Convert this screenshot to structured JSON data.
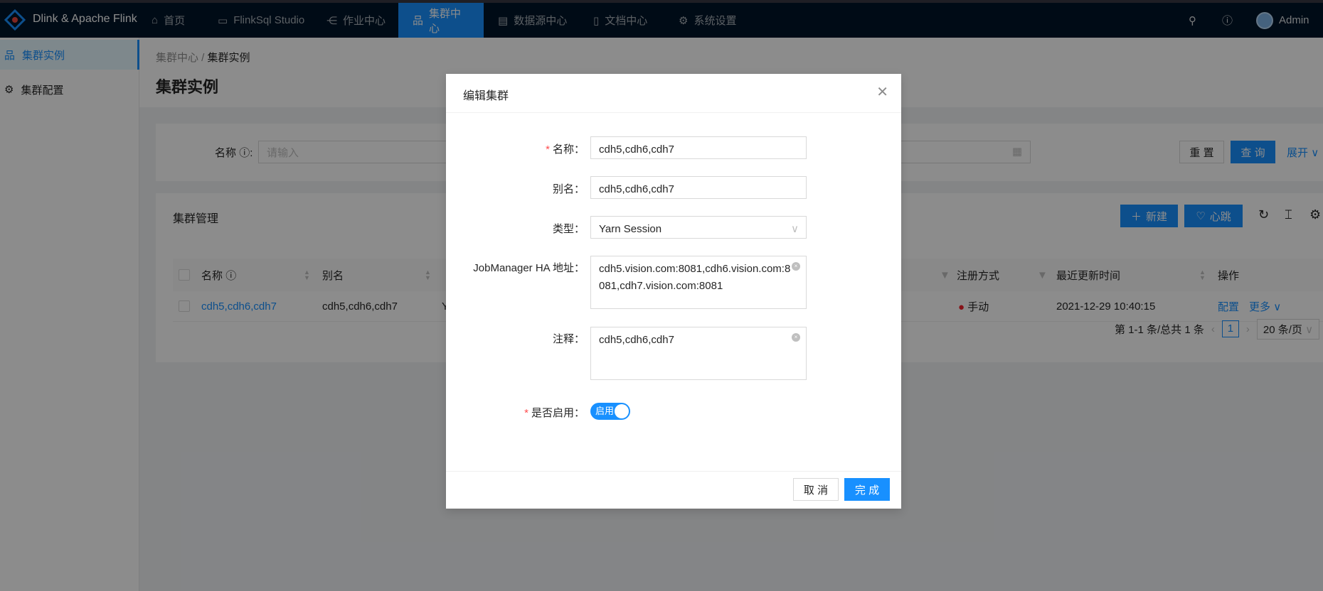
{
  "app": {
    "brand": "Dlink & Apache Flink",
    "user": "Admin",
    "accent": "#1890ff"
  },
  "nav": [
    {
      "label": "首页",
      "icon": "home-icon"
    },
    {
      "label": "FlinkSql Studio",
      "icon": "monitor-icon"
    },
    {
      "label": "作业中心",
      "icon": "node-icon"
    },
    {
      "label": "集群中心",
      "icon": "cluster-icon",
      "active": true
    },
    {
      "label": "数据源中心",
      "icon": "database-icon"
    },
    {
      "label": "文档中心",
      "icon": "document-icon"
    },
    {
      "label": "系统设置",
      "icon": "gear-icon"
    }
  ],
  "sidebar": [
    {
      "label": "集群实例",
      "selected": true
    },
    {
      "label": "集群配置"
    }
  ],
  "breadcrumb": {
    "parent": "集群中心",
    "current": "集群实例"
  },
  "page_title": "集群实例",
  "search": {
    "name_label": "名称",
    "name_placeholder": "请输入",
    "reset": "重 置",
    "query": "查 询",
    "expand": "展开"
  },
  "table": {
    "title": "集群管理",
    "new": "新建",
    "heartbeat": "心跳",
    "columns": [
      "名称",
      "别名",
      "注册方式",
      "最近更新时间",
      "操作"
    ],
    "rows": [
      {
        "name": "cdh5,cdh6,cdh7",
        "alias": "cdh5,cdh6,cdh7",
        "type_partial": "Y",
        "register": "手动",
        "updated": "2021-12-29 10:40:15",
        "action_config": "配置",
        "action_more": "更多"
      }
    ],
    "pagination": {
      "summary": "第 1-1 条/总共 1 条",
      "page": "1",
      "page_size": "20 条/页"
    }
  },
  "modal": {
    "title": "编辑集群",
    "name_label": "名称：",
    "name": "cdh5,cdh6,cdh7",
    "alias_label": "别名：",
    "alias": "cdh5,cdh6,cdh7",
    "type_label": "类型：",
    "type": "Yarn Session",
    "hosts_label": "JobManager HA 地址：",
    "hosts": "cdh5.vision.com:8081,cdh6.vision.com:8081,cdh7.vision.com:8081",
    "note_label": "注释：",
    "note": "cdh5,cdh6,cdh7",
    "enabled_label": "是否启用：",
    "enabled_text": "启用",
    "enabled": true,
    "cancel": "取 消",
    "ok": "完 成"
  }
}
